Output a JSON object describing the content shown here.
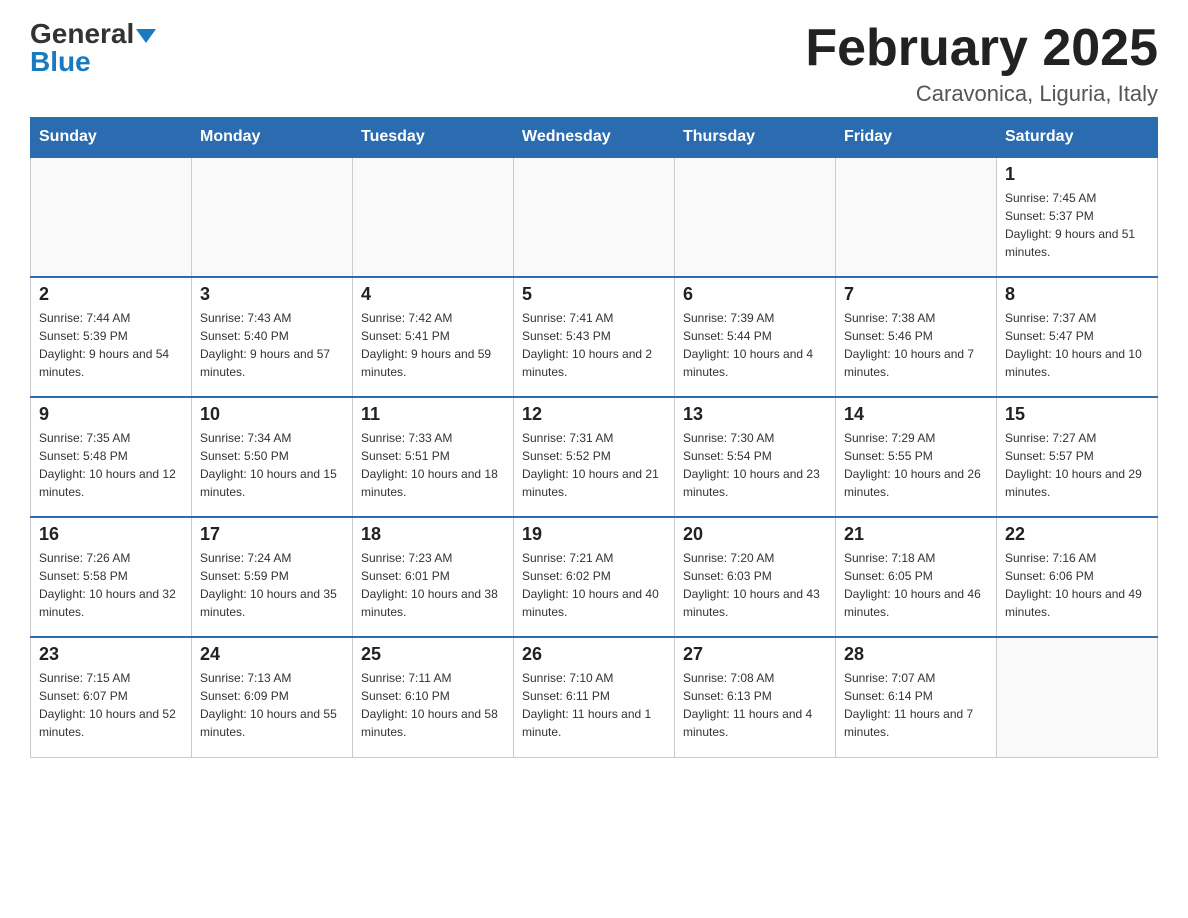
{
  "header": {
    "logo_general": "General",
    "logo_blue": "Blue",
    "month_title": "February 2025",
    "location": "Caravonica, Liguria, Italy"
  },
  "days_of_week": [
    "Sunday",
    "Monday",
    "Tuesday",
    "Wednesday",
    "Thursday",
    "Friday",
    "Saturday"
  ],
  "weeks": [
    [
      {
        "day": "",
        "info": ""
      },
      {
        "day": "",
        "info": ""
      },
      {
        "day": "",
        "info": ""
      },
      {
        "day": "",
        "info": ""
      },
      {
        "day": "",
        "info": ""
      },
      {
        "day": "",
        "info": ""
      },
      {
        "day": "1",
        "info": "Sunrise: 7:45 AM\nSunset: 5:37 PM\nDaylight: 9 hours and 51 minutes."
      }
    ],
    [
      {
        "day": "2",
        "info": "Sunrise: 7:44 AM\nSunset: 5:39 PM\nDaylight: 9 hours and 54 minutes."
      },
      {
        "day": "3",
        "info": "Sunrise: 7:43 AM\nSunset: 5:40 PM\nDaylight: 9 hours and 57 minutes."
      },
      {
        "day": "4",
        "info": "Sunrise: 7:42 AM\nSunset: 5:41 PM\nDaylight: 9 hours and 59 minutes."
      },
      {
        "day": "5",
        "info": "Sunrise: 7:41 AM\nSunset: 5:43 PM\nDaylight: 10 hours and 2 minutes."
      },
      {
        "day": "6",
        "info": "Sunrise: 7:39 AM\nSunset: 5:44 PM\nDaylight: 10 hours and 4 minutes."
      },
      {
        "day": "7",
        "info": "Sunrise: 7:38 AM\nSunset: 5:46 PM\nDaylight: 10 hours and 7 minutes."
      },
      {
        "day": "8",
        "info": "Sunrise: 7:37 AM\nSunset: 5:47 PM\nDaylight: 10 hours and 10 minutes."
      }
    ],
    [
      {
        "day": "9",
        "info": "Sunrise: 7:35 AM\nSunset: 5:48 PM\nDaylight: 10 hours and 12 minutes."
      },
      {
        "day": "10",
        "info": "Sunrise: 7:34 AM\nSunset: 5:50 PM\nDaylight: 10 hours and 15 minutes."
      },
      {
        "day": "11",
        "info": "Sunrise: 7:33 AM\nSunset: 5:51 PM\nDaylight: 10 hours and 18 minutes."
      },
      {
        "day": "12",
        "info": "Sunrise: 7:31 AM\nSunset: 5:52 PM\nDaylight: 10 hours and 21 minutes."
      },
      {
        "day": "13",
        "info": "Sunrise: 7:30 AM\nSunset: 5:54 PM\nDaylight: 10 hours and 23 minutes."
      },
      {
        "day": "14",
        "info": "Sunrise: 7:29 AM\nSunset: 5:55 PM\nDaylight: 10 hours and 26 minutes."
      },
      {
        "day": "15",
        "info": "Sunrise: 7:27 AM\nSunset: 5:57 PM\nDaylight: 10 hours and 29 minutes."
      }
    ],
    [
      {
        "day": "16",
        "info": "Sunrise: 7:26 AM\nSunset: 5:58 PM\nDaylight: 10 hours and 32 minutes."
      },
      {
        "day": "17",
        "info": "Sunrise: 7:24 AM\nSunset: 5:59 PM\nDaylight: 10 hours and 35 minutes."
      },
      {
        "day": "18",
        "info": "Sunrise: 7:23 AM\nSunset: 6:01 PM\nDaylight: 10 hours and 38 minutes."
      },
      {
        "day": "19",
        "info": "Sunrise: 7:21 AM\nSunset: 6:02 PM\nDaylight: 10 hours and 40 minutes."
      },
      {
        "day": "20",
        "info": "Sunrise: 7:20 AM\nSunset: 6:03 PM\nDaylight: 10 hours and 43 minutes."
      },
      {
        "day": "21",
        "info": "Sunrise: 7:18 AM\nSunset: 6:05 PM\nDaylight: 10 hours and 46 minutes."
      },
      {
        "day": "22",
        "info": "Sunrise: 7:16 AM\nSunset: 6:06 PM\nDaylight: 10 hours and 49 minutes."
      }
    ],
    [
      {
        "day": "23",
        "info": "Sunrise: 7:15 AM\nSunset: 6:07 PM\nDaylight: 10 hours and 52 minutes."
      },
      {
        "day": "24",
        "info": "Sunrise: 7:13 AM\nSunset: 6:09 PM\nDaylight: 10 hours and 55 minutes."
      },
      {
        "day": "25",
        "info": "Sunrise: 7:11 AM\nSunset: 6:10 PM\nDaylight: 10 hours and 58 minutes."
      },
      {
        "day": "26",
        "info": "Sunrise: 7:10 AM\nSunset: 6:11 PM\nDaylight: 11 hours and 1 minute."
      },
      {
        "day": "27",
        "info": "Sunrise: 7:08 AM\nSunset: 6:13 PM\nDaylight: 11 hours and 4 minutes."
      },
      {
        "day": "28",
        "info": "Sunrise: 7:07 AM\nSunset: 6:14 PM\nDaylight: 11 hours and 7 minutes."
      },
      {
        "day": "",
        "info": ""
      }
    ]
  ]
}
